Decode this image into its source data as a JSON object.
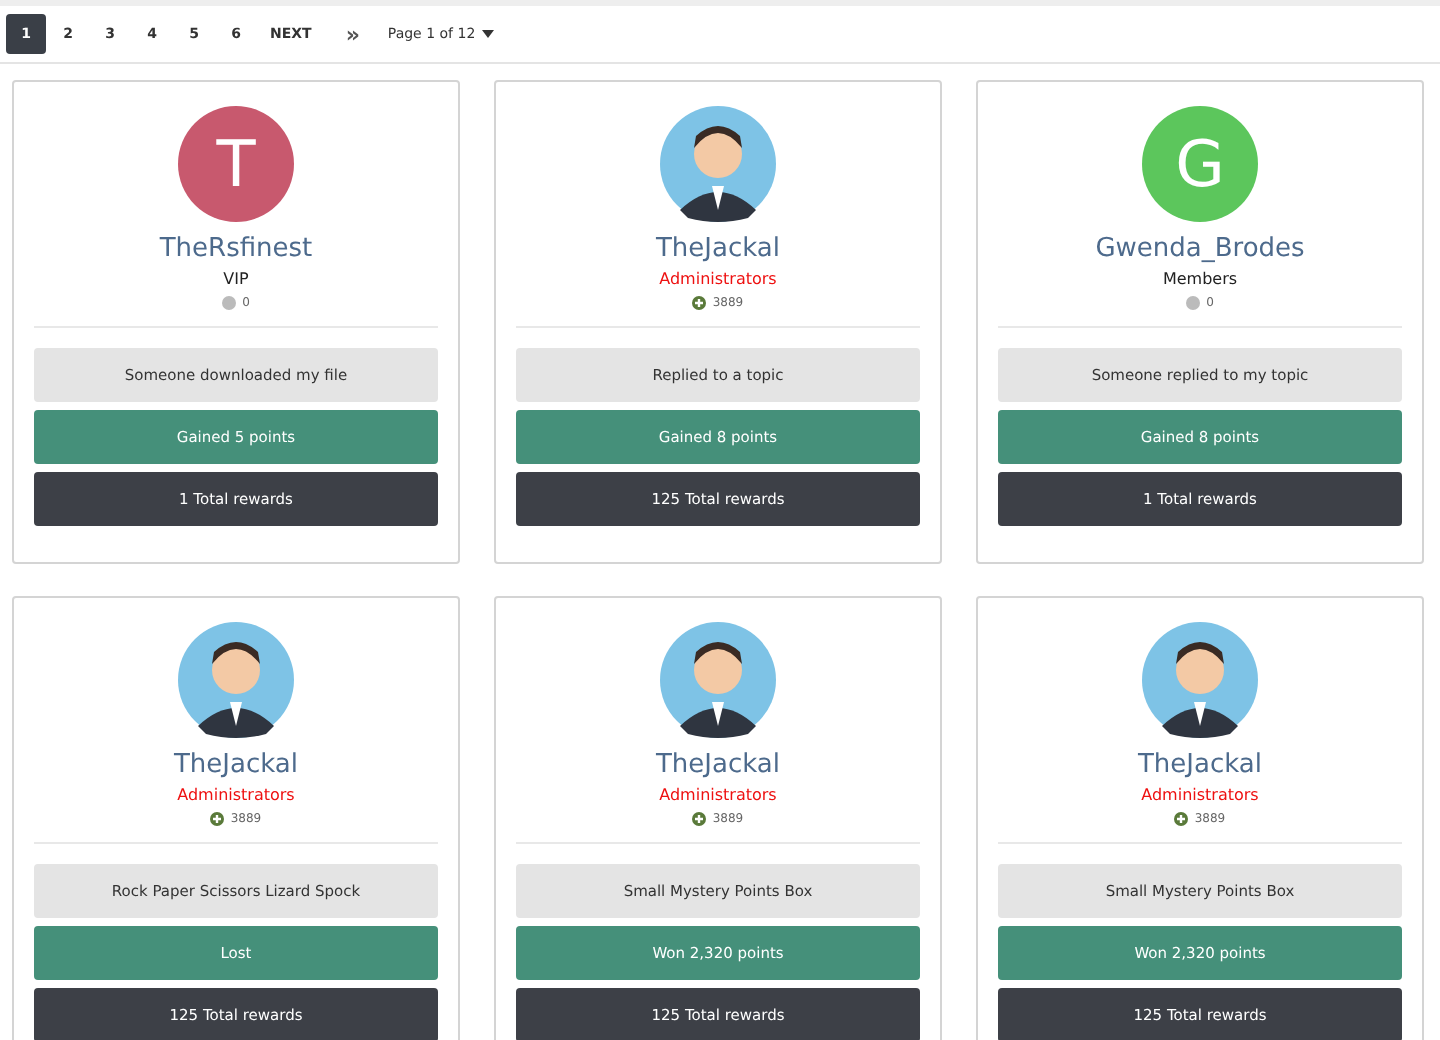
{
  "pagination": {
    "pages": [
      {
        "label": "1",
        "selected": true
      },
      {
        "label": "2",
        "selected": false
      },
      {
        "label": "3",
        "selected": false
      },
      {
        "label": "4",
        "selected": false
      },
      {
        "label": "5",
        "selected": false
      },
      {
        "label": "6",
        "selected": false
      }
    ],
    "next": "NEXT",
    "last": "»",
    "page_select": "Page 1 of 12"
  },
  "cards": [
    {
      "avatar": {
        "kind": "letter",
        "letter": "T",
        "color": "#c8596e"
      },
      "name": "TheRsfinest",
      "role": {
        "text": "VIP",
        "color": "#222222"
      },
      "points": {
        "kind": "none",
        "value": "0"
      },
      "activity": "Someone downloaded my file",
      "result": "Gained 5 points",
      "total": "1 Total rewards"
    },
    {
      "avatar": {
        "kind": "illustration"
      },
      "name": "TheJackal",
      "role": {
        "text": "Administrators",
        "color": "#ee1111"
      },
      "points": {
        "kind": "plus",
        "value": "3889"
      },
      "activity": "Replied to a topic",
      "result": "Gained 8 points",
      "total": "125 Total rewards"
    },
    {
      "avatar": {
        "kind": "letter",
        "letter": "G",
        "color": "#5cc65c"
      },
      "name": "Gwenda_Brodes",
      "role": {
        "text": "Members",
        "color": "#222222"
      },
      "points": {
        "kind": "none",
        "value": "0"
      },
      "activity": "Someone replied to my topic",
      "result": "Gained 8 points",
      "total": "1 Total rewards"
    },
    {
      "avatar": {
        "kind": "illustration"
      },
      "name": "TheJackal",
      "role": {
        "text": "Administrators",
        "color": "#ee1111"
      },
      "points": {
        "kind": "plus",
        "value": "3889"
      },
      "activity": "Rock Paper Scissors Lizard Spock",
      "result": "Lost",
      "total": "125 Total rewards"
    },
    {
      "avatar": {
        "kind": "illustration"
      },
      "name": "TheJackal",
      "role": {
        "text": "Administrators",
        "color": "#ee1111"
      },
      "points": {
        "kind": "plus",
        "value": "3889"
      },
      "activity": "Small Mystery Points Box",
      "result": "Won 2,320 points",
      "total": "125 Total rewards"
    },
    {
      "avatar": {
        "kind": "illustration"
      },
      "name": "TheJackal",
      "role": {
        "text": "Administrators",
        "color": "#ee1111"
      },
      "points": {
        "kind": "plus",
        "value": "3889"
      },
      "activity": "Small Mystery Points Box",
      "result": "Won 2,320 points",
      "total": "125 Total rewards"
    }
  ]
}
